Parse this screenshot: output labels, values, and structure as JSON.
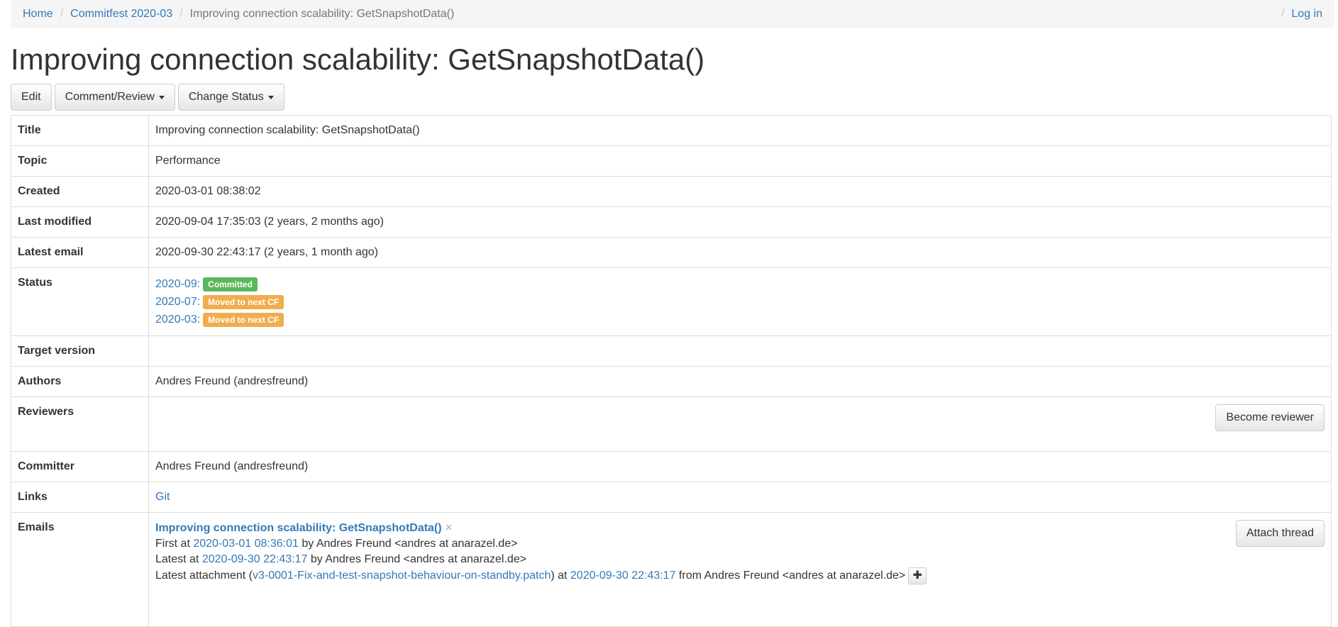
{
  "breadcrumb": {
    "home": "Home",
    "commitfest": "Commitfest 2020-03",
    "current": "Improving connection scalability: GetSnapshotData()",
    "login": "Log in"
  },
  "page_title": "Improving connection scalability: GetSnapshotData()",
  "toolbar": {
    "edit": "Edit",
    "comment_review": "Comment/Review",
    "change_status": "Change Status"
  },
  "details": {
    "title": {
      "label": "Title",
      "value": "Improving connection scalability: GetSnapshotData()"
    },
    "topic": {
      "label": "Topic",
      "value": "Performance"
    },
    "created": {
      "label": "Created",
      "value": "2020-03-01 08:38:02"
    },
    "last_modified": {
      "label": "Last modified",
      "value": "2020-09-04 17:35:03 (2 years, 2 months ago)"
    },
    "latest_email": {
      "label": "Latest email",
      "value": "2020-09-30 22:43:17 (2 years, 1 month ago)"
    },
    "status": {
      "label": "Status",
      "entries": [
        {
          "cf": "2020-09:",
          "badge": "Committed",
          "color": "#5cb85c"
        },
        {
          "cf": "2020-07:",
          "badge": "Moved to next CF",
          "color": "#f0ad4e"
        },
        {
          "cf": "2020-03:",
          "badge": "Moved to next CF",
          "color": "#f0ad4e"
        }
      ]
    },
    "target_version": {
      "label": "Target version",
      "value": ""
    },
    "authors": {
      "label": "Authors",
      "value": "Andres Freund (andresfreund)"
    },
    "reviewers": {
      "label": "Reviewers",
      "button": "Become reviewer"
    },
    "committer": {
      "label": "Committer",
      "value": "Andres Freund (andresfreund)"
    },
    "links": {
      "label": "Links",
      "git": "Git"
    },
    "emails": {
      "label": "Emails",
      "thread_title": "Improving connection scalability: GetSnapshotData()",
      "remove_icon": "×",
      "attach_button": "Attach thread",
      "first_prefix": "First at ",
      "first_date": "2020-03-01 08:36:01",
      "first_suffix": " by Andres Freund <andres at anarazel.de>",
      "latest_prefix": "Latest at ",
      "latest_date": "2020-09-30 22:43:17",
      "latest_suffix": " by Andres Freund <andres at anarazel.de>",
      "attachment_prefix": "Latest attachment (",
      "attachment_file": "v3-0001-Fix-and-test-snapshot-behaviour-on-standby.patch",
      "attachment_mid": ") at ",
      "attachment_date": "2020-09-30 22:43:17",
      "attachment_suffix": " from Andres Freund <andres at anarazel.de>",
      "plus_icon": "✚"
    }
  }
}
